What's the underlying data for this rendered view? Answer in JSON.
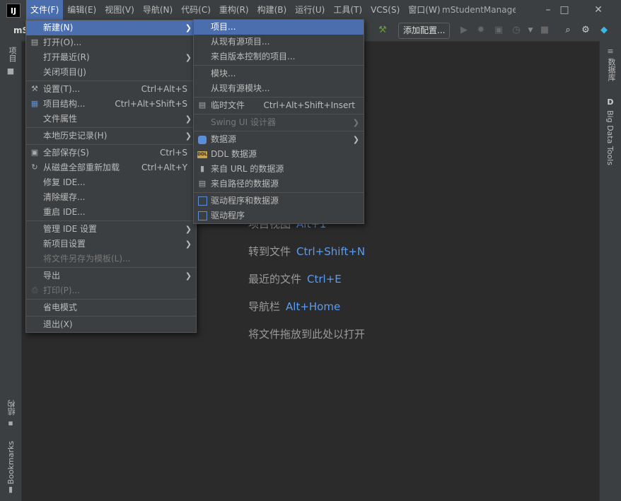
{
  "menubar": {
    "logo": "IJ",
    "items": [
      "文件(F)",
      "编辑(E)",
      "视图(V)",
      "导航(N)",
      "代码(C)",
      "重构(R)",
      "构建(B)",
      "运行(U)",
      "工具(T)",
      "VCS(S)",
      "窗口(W)"
    ],
    "window_title": "mStudentManage"
  },
  "toolbar": {
    "project_label": "mS",
    "add_config_label": "添加配置..."
  },
  "left_strip": {
    "project": "项目",
    "structure": "结构",
    "bookmarks": "Bookmarks"
  },
  "right_strip": {
    "database": "数据库",
    "bigdata": "Big Data Tools",
    "bigdata_letter": "D"
  },
  "editor_hints": [
    {
      "label": "项目视图",
      "key": "Alt+1"
    },
    {
      "label": "转到文件",
      "key": "Ctrl+Shift+N"
    },
    {
      "label": "最近的文件",
      "key": "Ctrl+E"
    },
    {
      "label": "导航栏",
      "key": "Alt+Home"
    },
    {
      "label": "将文件拖放到此处以打开",
      "key": ""
    }
  ],
  "file_menu": {
    "new": "新建(N)",
    "open": "打开(O)...",
    "open_recent": "打开最近(R)",
    "close_project": "关闭项目(J)",
    "settings": "设置(T)...",
    "settings_sc": "Ctrl+Alt+S",
    "project_structure": "项目结构...",
    "project_structure_sc": "Ctrl+Alt+Shift+S",
    "file_properties": "文件属性",
    "local_history": "本地历史记录(H)",
    "save_all": "全部保存(S)",
    "save_all_sc": "Ctrl+S",
    "reload": "从磁盘全部重新加载",
    "reload_sc": "Ctrl+Alt+Y",
    "repair_ide": "修复 IDE...",
    "invalidate_caches": "清除缓存...",
    "restart_ide": "重启 IDE...",
    "manage_ide_settings": "管理 IDE 设置",
    "new_project_settings": "新项目设置",
    "save_as_template": "将文件另存为模板(L)...",
    "export": "导出",
    "print": "打印(P)...",
    "power_save": "省电模式",
    "exit": "退出(X)"
  },
  "new_submenu": {
    "project": "项目...",
    "project_from_existing": "从现有源项目...",
    "project_from_vcs": "来自版本控制的项目...",
    "module": "模块...",
    "module_from_existing": "从现有源模块...",
    "scratch_file": "临时文件",
    "scratch_file_sc": "Ctrl+Alt+Shift+Insert",
    "swing_ui": "Swing UI 设计器",
    "data_source": "数据源",
    "ddl_data_source": "DDL 数据源",
    "data_source_url": "来自 URL 的数据源",
    "data_source_path": "来自路径的数据源",
    "driver_and_ds": "驱动程序和数据源",
    "driver": "驱动程序"
  }
}
